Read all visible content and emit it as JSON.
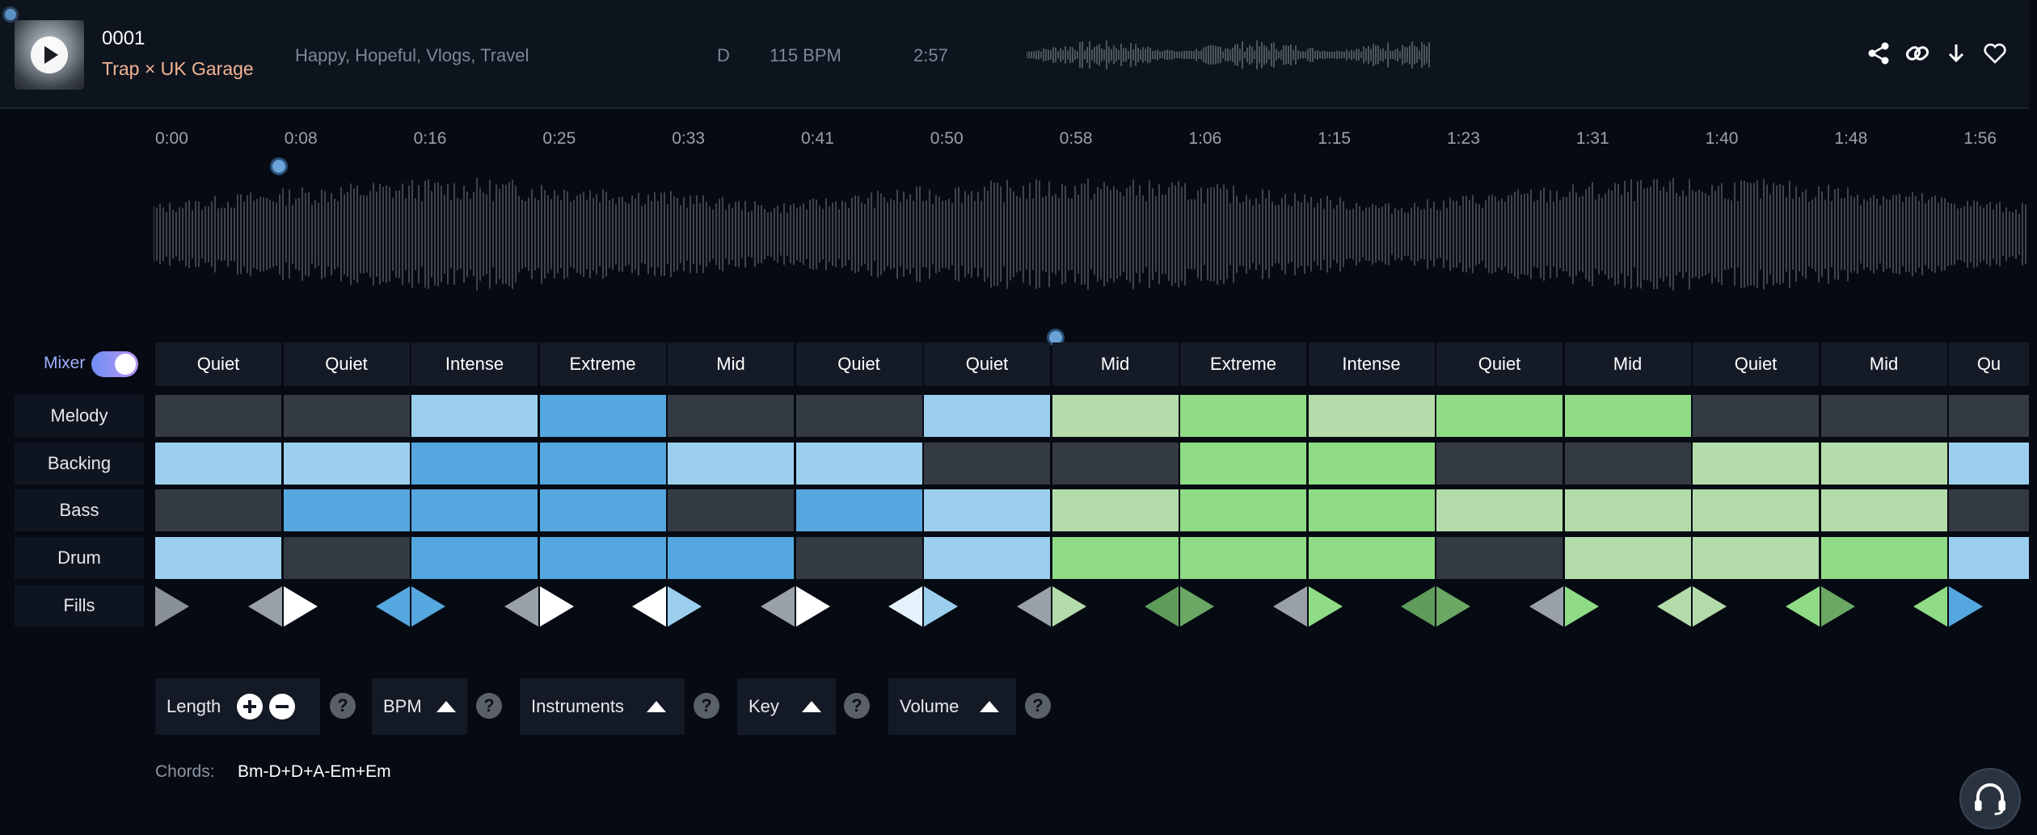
{
  "track": {
    "title": "0001",
    "genre": "Trap × UK Garage",
    "tags": "Happy, Hopeful, Vlogs, Travel",
    "key": "D",
    "bpm": "115 BPM",
    "duration": "2:57"
  },
  "header_icons": [
    "share-icon",
    "link-icon",
    "download-icon",
    "heart-icon"
  ],
  "timeline": {
    "ticks": [
      "0:00",
      "0:08",
      "0:16",
      "0:25",
      "0:33",
      "0:41",
      "0:50",
      "0:58",
      "1:06",
      "1:15",
      "1:23",
      "1:31",
      "1:40",
      "1:48",
      "1:56"
    ]
  },
  "mixer": {
    "label": "Mixer",
    "enabled": true
  },
  "rows": {
    "melody": "Melody",
    "backing": "Backing",
    "bass": "Bass",
    "drum": "Drum",
    "fills": "Fills"
  },
  "sections": [
    "Quiet",
    "Quiet",
    "Intense",
    "Extreme",
    "Mid",
    "Quiet",
    "Quiet",
    "Mid",
    "Extreme",
    "Intense",
    "Quiet",
    "Mid",
    "Quiet",
    "Mid",
    "Qu"
  ],
  "grid": {
    "melody": [
      "off",
      "off",
      "light-blue",
      "blue",
      "off",
      "off",
      "light-blue",
      "light-green",
      "green",
      "light-green",
      "green",
      "green",
      "off",
      "off",
      "off"
    ],
    "backing": [
      "light-blue",
      "light-blue",
      "blue",
      "blue",
      "light-blue",
      "light-blue",
      "off",
      "off",
      "green",
      "green",
      "off",
      "off",
      "light-green",
      "light-green",
      "light-blue"
    ],
    "bass": [
      "off",
      "blue",
      "blue",
      "blue",
      "off",
      "blue",
      "light-blue",
      "light-green",
      "green",
      "green",
      "light-green",
      "light-green",
      "light-green",
      "light-green",
      "off"
    ],
    "drum": [
      "light-blue",
      "off",
      "blue",
      "blue",
      "blue",
      "off",
      "light-blue",
      "green",
      "green",
      "green",
      "off",
      "light-green",
      "light-green",
      "green",
      "light-blue"
    ]
  },
  "colors": {
    "off": "#343a43",
    "light-blue": "#9ccfee",
    "blue": "#55a7df",
    "light-green": "#b3dcaa",
    "green": "#8fdb86"
  },
  "controls": {
    "length": "Length",
    "bpm": "BPM",
    "instruments": "Instruments",
    "key": "Key",
    "volume": "Volume",
    "help_glyph": "?"
  },
  "chords": {
    "label": "Chords:",
    "value": "Bm-D+D+A-Em+Em"
  }
}
